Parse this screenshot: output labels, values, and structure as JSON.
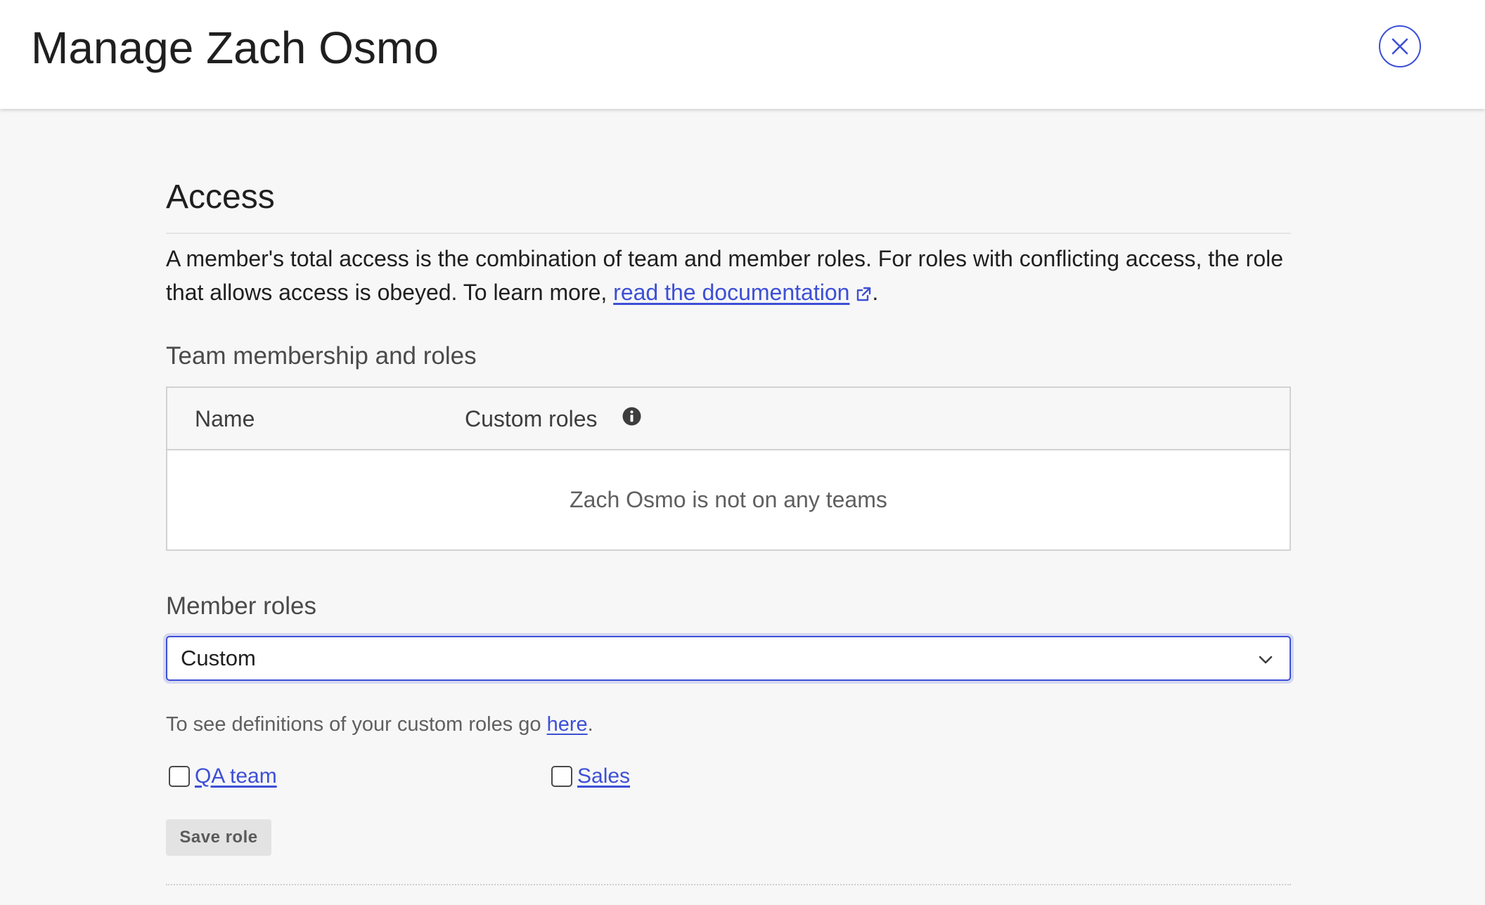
{
  "header": {
    "title": "Manage Zach Osmo",
    "close_icon": "close-icon"
  },
  "access": {
    "title": "Access",
    "intro_text": "A member's total access is the combination of team and member roles. For roles with conflicting access, the role that allows access is obeyed. To learn more, ",
    "doc_link_label": "read the documentation",
    "doc_link_icon": "external-link-icon",
    "intro_end": "."
  },
  "team_membership": {
    "heading": "Team membership and roles",
    "columns": {
      "name": "Name",
      "custom_roles": "Custom roles"
    },
    "info_icon": "info-icon",
    "empty_message": "Zach Osmo is not on any teams"
  },
  "member_roles": {
    "heading": "Member roles",
    "selected_value": "Custom",
    "dropdown_icon": "chevron-down-icon",
    "help_text": "To see definitions of your custom roles go ",
    "help_link_label": "here",
    "help_text_end": ".",
    "custom_roles": [
      {
        "label": "QA team",
        "checked": false
      },
      {
        "label": "Sales",
        "checked": false
      }
    ],
    "save_label": "Save role"
  },
  "colors": {
    "accent": "#3d4fd6",
    "background": "#f7f7f7",
    "text_muted": "#5f5f5f"
  }
}
